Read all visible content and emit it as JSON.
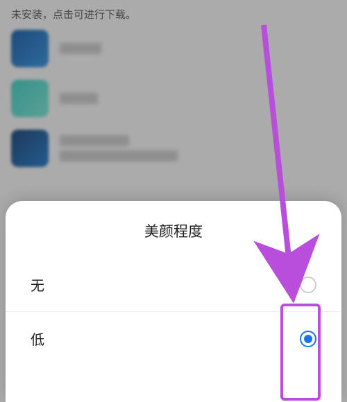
{
  "backdrop": {
    "hint": "未安装，点击可进行下载。"
  },
  "sheet": {
    "title": "美颜程度",
    "options": [
      {
        "label": "无",
        "selected": false
      },
      {
        "label": "低",
        "selected": true
      }
    ]
  },
  "colors": {
    "accent_arrow": "#b84edb",
    "radio_selected": "#1a73e8"
  }
}
